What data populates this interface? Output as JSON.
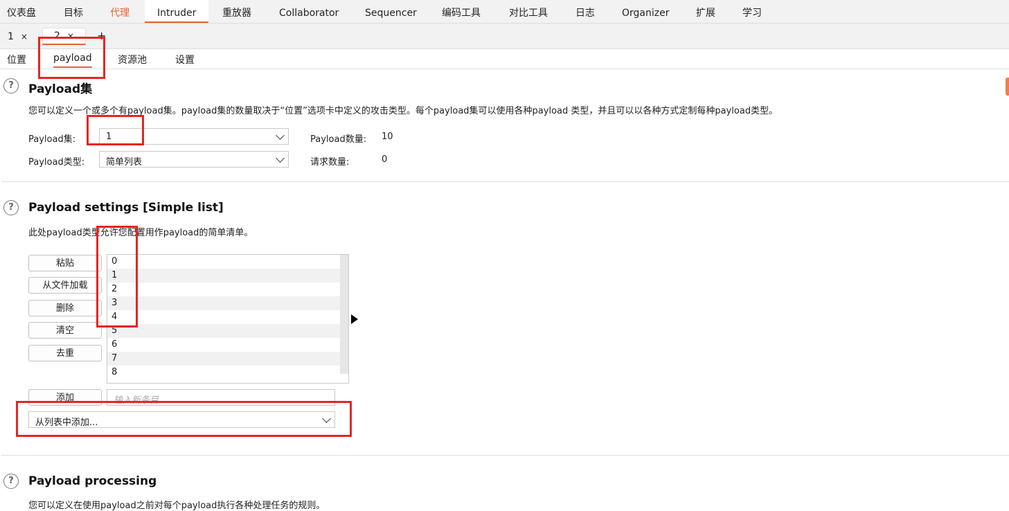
{
  "topnav": [
    "仪表盘",
    "目标",
    "代理",
    "Intruder",
    "重放器",
    "Collaborator",
    "Sequencer",
    "编码工具",
    "对比工具",
    "日志",
    "Organizer",
    "扩展",
    "学习"
  ],
  "subtabs": {
    "tab1": "1",
    "tab2": "2",
    "close": "×",
    "plus": "+"
  },
  "thirdtabs": [
    "位置",
    "payload",
    "资源池",
    "设置"
  ],
  "payload_sets": {
    "title": "Payload集",
    "desc": "您可以定义一个或多个有payload集。payload集的数量取决于“位置”选项卡中定义的攻击类型。每个payload集可以使用各种payload 类型，并且可以以各种方式定制每种payload类型。",
    "set_label": "Payload集:",
    "set_value": "1",
    "type_label": "Payload类型:",
    "type_value": "简单列表",
    "count_label": "Payload数量:",
    "count_value": "10",
    "req_label": "请求数量:",
    "req_value": "0"
  },
  "settings": {
    "title": "Payload settings [Simple list]",
    "desc": "此处payload类型允许您配置用作payload的简单清单。",
    "buttons": {
      "paste": "粘贴",
      "load": "从文件加载",
      "remove": "删除",
      "clear": "清空",
      "dedupe": "去重",
      "add": "添加"
    },
    "items": [
      "0",
      "1",
      "2",
      "3",
      "4",
      "5",
      "6",
      "7",
      "8"
    ],
    "add_placeholder": "输入新条目",
    "add_from_list": "从列表中添加..."
  },
  "processing": {
    "title": "Payload processing",
    "desc": "您可以定义在使用payload之前对每个payload执行各种处理任务的规则。"
  }
}
